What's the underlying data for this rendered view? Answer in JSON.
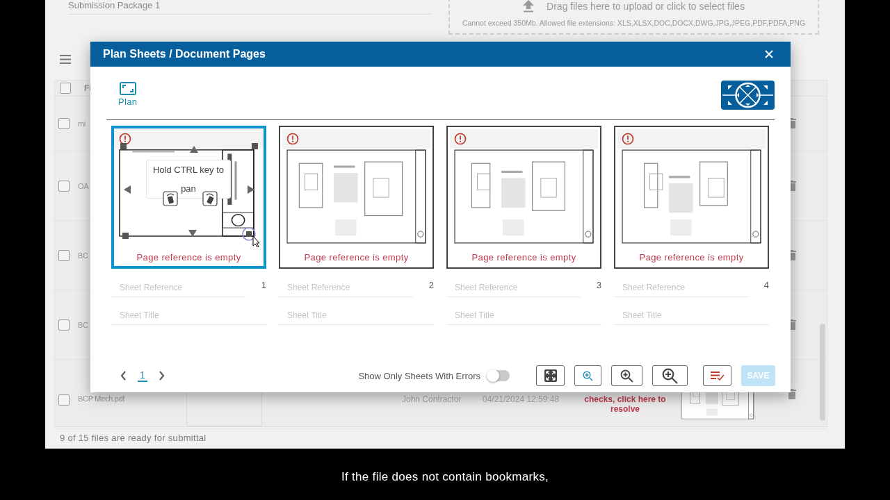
{
  "background": {
    "package_field": {
      "value": "Submission Package 1"
    },
    "upload": {
      "title": "Drag files here to upload or click to select files",
      "hint": "Cannot exceed 350Mb. Allowed file extensions: XLS,XLSX,DOC,DOCX,DWG,JPG,JPEG,PDF,PDFA,PNG"
    },
    "table": {
      "header": {
        "checked": false,
        "column_1": "Fi"
      },
      "rows": [
        {
          "checked": false,
          "name": "mi"
        },
        {
          "checked": false,
          "name": "OA"
        },
        {
          "checked": false,
          "name": "BC"
        },
        {
          "checked": false,
          "name": "BC"
        },
        {
          "checked": false,
          "name": "BCP Mech.pdf",
          "uploader": "John Contractor",
          "date": "04/21/2024 12:59:48",
          "status": "checks, click here to resolve"
        }
      ]
    },
    "status_bar": "9 of 15 files are ready for submittal"
  },
  "dialog": {
    "title": "Plan Sheets / Document Pages",
    "tabs": [
      {
        "label": "Plan",
        "selected": true
      }
    ],
    "sheets": [
      {
        "number": "1",
        "selected": true,
        "error": "Page reference is empty",
        "pan_hint": "Hold CTRL key to pan",
        "reference": {
          "placeholder": "Sheet Reference"
        },
        "title": {
          "placeholder": "Sheet Title"
        }
      },
      {
        "number": "2",
        "selected": false,
        "error": "Page reference is empty",
        "reference": {
          "placeholder": "Sheet Reference"
        },
        "title": {
          "placeholder": "Sheet Title"
        }
      },
      {
        "number": "3",
        "selected": false,
        "error": "Page reference is empty",
        "reference": {
          "placeholder": "Sheet Reference"
        },
        "title": {
          "placeholder": "Sheet Title"
        }
      },
      {
        "number": "4",
        "selected": false,
        "error": "Page reference is empty",
        "reference": {
          "placeholder": "Sheet Reference"
        },
        "title": {
          "placeholder": "Sheet Title"
        }
      }
    ],
    "pager": [
      {
        "label": "1",
        "selected": true
      }
    ],
    "errors_filter": {
      "label": "Show Only Sheets With Errors",
      "on": false
    },
    "save": {
      "label": "SAVE",
      "disabled": true
    }
  },
  "subtitle": "If the file does not contain bookmarks,"
}
